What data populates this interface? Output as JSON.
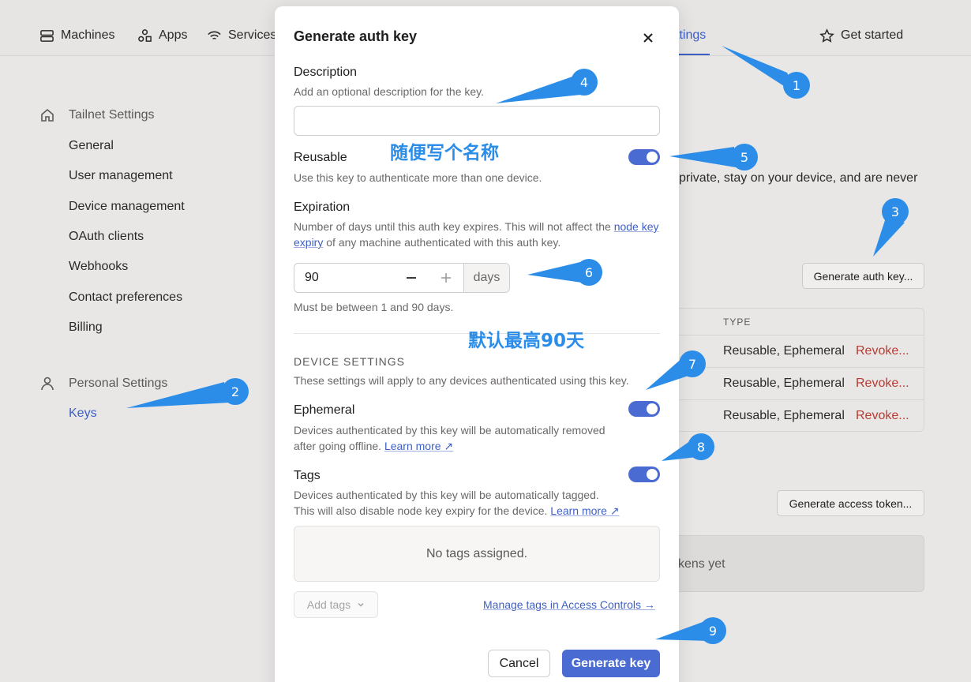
{
  "nav": {
    "machines": "Machines",
    "apps": "Apps",
    "services": "Services",
    "settings_partial": "ttings",
    "get_started": "Get started"
  },
  "sidebar": {
    "tailnet_heading": "Tailnet Settings",
    "items": [
      "General",
      "User management",
      "Device management",
      "OAuth clients",
      "Webhooks",
      "Contact preferences",
      "Billing"
    ],
    "personal_heading": "Personal Settings",
    "keys": "Keys"
  },
  "background": {
    "desc_partial": "private, stay on your device, and are never",
    "generate_auth_key_button": "Generate auth key...",
    "table_header_type": "TYPE",
    "rows": [
      {
        "type": "Reusable, Ephemeral",
        "action": "Revoke..."
      },
      {
        "type": "Reusable, Ephemeral",
        "action": "Revoke..."
      },
      {
        "type": "Reusable, Ephemeral",
        "action": "Revoke..."
      }
    ],
    "generate_access_token_button": "Generate access token...",
    "empty_partial": "kens yet"
  },
  "modal": {
    "title": "Generate auth key",
    "description": {
      "label": "Description",
      "help": "Add an optional description for the key.",
      "value": ""
    },
    "reusable": {
      "label": "Reusable",
      "help": "Use this key to authenticate more than one device.",
      "enabled": true
    },
    "expiration": {
      "label": "Expiration",
      "help_pre": "Number of days until this auth key expires. This will not affect the",
      "help_link": "node key expiry",
      "help_post": "of any machine authenticated with this auth key.",
      "value": "90",
      "unit": "days",
      "note": "Must be between 1 and 90 days."
    },
    "device_settings": {
      "caption": "DEVICE SETTINGS",
      "help": "These settings will apply to any devices authenticated using this key."
    },
    "ephemeral": {
      "label": "Ephemeral",
      "help_line1": "Devices authenticated by this key will be automatically removed",
      "help_line2": "after going offline.",
      "learn_more": "Learn more ↗",
      "enabled": true
    },
    "tags": {
      "label": "Tags",
      "help_line1": "Devices authenticated by this key will be automatically tagged.",
      "help_line2": "This will also disable node key expiry for the device.",
      "learn_more": "Learn more ↗",
      "enabled": true,
      "empty": "No tags assigned.",
      "add_tags": "Add tags",
      "manage_link": "Manage tags in Access Controls →"
    },
    "cancel": "Cancel",
    "generate": "Generate key"
  },
  "annotations": {
    "color": "#2b8de8",
    "callouts": [
      "1",
      "2",
      "3",
      "4",
      "5",
      "6",
      "7",
      "8",
      "9"
    ],
    "note_name": "随便写个名称",
    "note_max": "默认最高90天"
  }
}
